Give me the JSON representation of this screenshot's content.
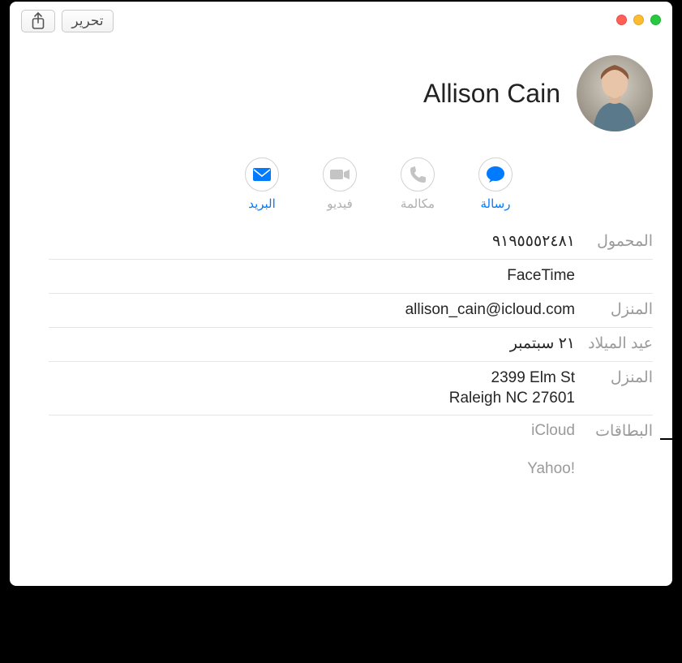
{
  "toolbar": {
    "edit_label": "تحرير"
  },
  "contact": {
    "name": "Allison Cain"
  },
  "actions": {
    "message": "رسالة",
    "call": "مكالمة",
    "video": "فيديو",
    "mail": "البريد"
  },
  "fields": {
    "mobile_label": "المحمول",
    "mobile_value": "٩١٩٥٥٥٢٤٨١",
    "facetime_label": "",
    "facetime_value": "FaceTime",
    "home_email_label": "المنزل",
    "home_email_value": "allison_cain@icloud.com",
    "birthday_label": "عيد الميلاد",
    "birthday_value": "٢١ سبتمبر",
    "home_addr_label": "المنزل",
    "home_addr_line1": "2399 Elm St",
    "home_addr_line2": "Raleigh NC 27601",
    "cards_label": "البطاقات",
    "cards_v1": "iCloud",
    "cards_v2": "Yahoo!"
  }
}
